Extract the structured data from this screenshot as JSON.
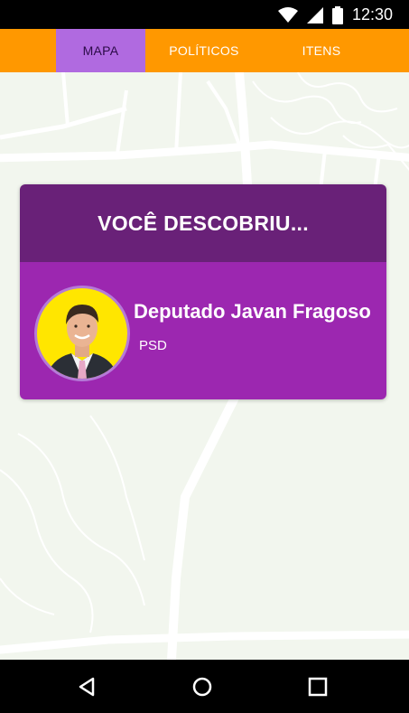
{
  "status_bar": {
    "time": "12:30",
    "icons": [
      "wifi-icon",
      "signal-icon",
      "battery-icon"
    ]
  },
  "tabs": [
    {
      "label": "MAPA",
      "active": true
    },
    {
      "label": "POLÍTICOS",
      "active": false
    },
    {
      "label": "ITENS",
      "active": false
    }
  ],
  "discovery_card": {
    "title": "VOCÊ DESCOBRIU...",
    "name": "Deputado Javan Fragoso",
    "party": "PSD"
  },
  "nav_bar": {
    "icons": [
      "back-icon",
      "home-icon",
      "recents-icon"
    ]
  },
  "colors": {
    "app_bar": "#ff9800",
    "active_tab": "#b06ae0",
    "card_header": "#692178",
    "card_body": "#9c27b0",
    "avatar_bg": "#ffe600",
    "map_bg": "#f2f6ee"
  }
}
